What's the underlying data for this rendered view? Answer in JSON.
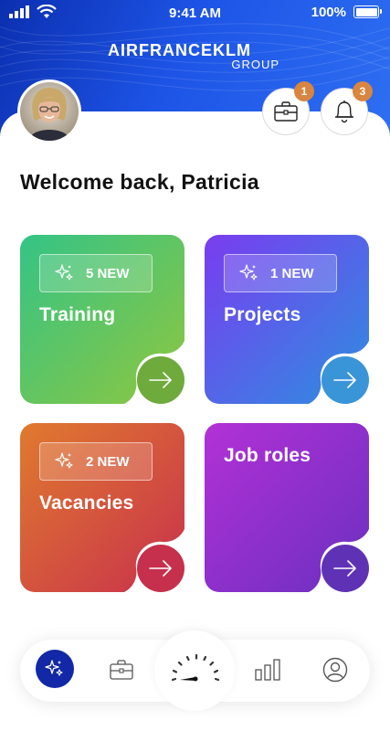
{
  "status_bar": {
    "time": "9:41 AM",
    "battery_text": "100%",
    "battery_level": 1.0
  },
  "brand": {
    "logo_main": "AIRFRANCEKLM",
    "logo_sub": "GROUP"
  },
  "header": {
    "briefcase_badge": "1",
    "bell_badge": "3",
    "avatar_icon": "user-photo"
  },
  "welcome_text": "Welcome back, Patricia",
  "tiles": [
    {
      "title": "Training",
      "chip": "5 NEW",
      "icon": "sparkle-icon",
      "gradient": [
        "#34c486",
        "#8fc63f"
      ],
      "arrow_color": "#6faa3c"
    },
    {
      "title": "Projects",
      "chip": "1 NEW",
      "icon": "sparkle-icon",
      "gradient": [
        "#7a3cf0",
        "#2d8fe0"
      ],
      "arrow_color": "#3a94d8"
    },
    {
      "title": "Vacancies",
      "chip": "2 NEW",
      "icon": "sparkle-icon",
      "gradient": [
        "#e07a2e",
        "#c8304d"
      ],
      "arrow_color": "#c6304c"
    },
    {
      "title": "Job roles",
      "chip": "",
      "icon": "",
      "gradient": [
        "#b331d6",
        "#6a2fc0"
      ],
      "arrow_color": "#5f32b5"
    }
  ],
  "bottom_nav": {
    "items": [
      "sparkle-icon",
      "briefcase-icon",
      "gauge-icon",
      "bar-chart-icon",
      "profile-icon"
    ],
    "active": "sparkle-icon",
    "active_color": "#1228a6"
  }
}
